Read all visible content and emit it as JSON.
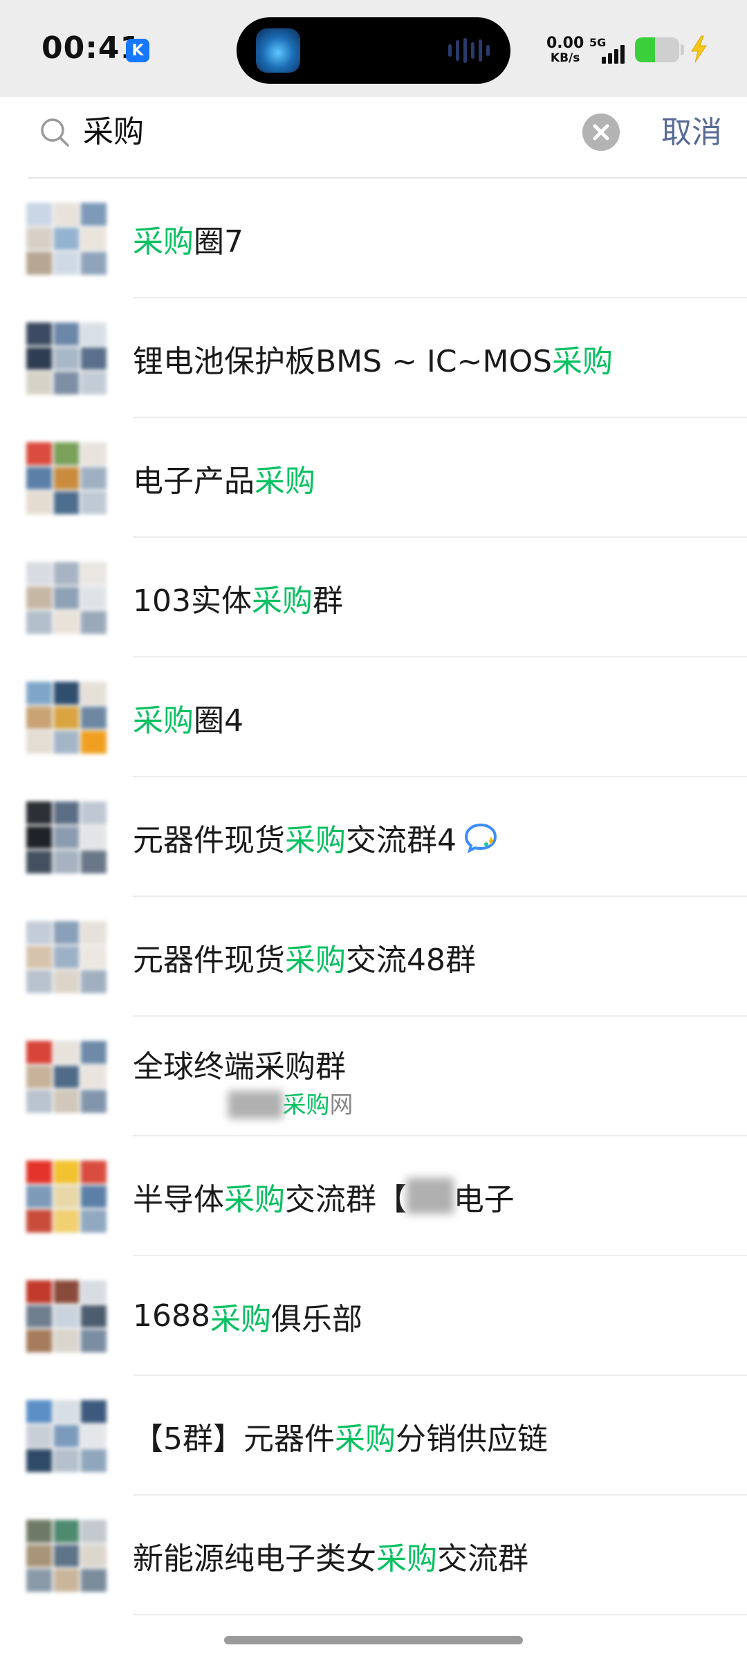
{
  "status_bar": {
    "time": "00:41",
    "badge": "K",
    "net_speed": "0.00",
    "net_unit": "KB/s",
    "net_type": "5G",
    "battery_level": 0.45,
    "charging_icon": "bolt-icon"
  },
  "search": {
    "query": "采购",
    "cancel_label": "取消",
    "search_icon": "search-icon",
    "clear_icon": "clear-icon"
  },
  "results": [
    {
      "pre": "",
      "hl": "采购",
      "post": "圈7",
      "sub_pre": "",
      "sub_hl": "",
      "sub_post": ""
    },
    {
      "pre": "锂电池保护板BMS ~ IC~MOS",
      "hl": "采购",
      "post": "",
      "sub_pre": "",
      "sub_hl": "",
      "sub_post": ""
    },
    {
      "pre": "电子产品",
      "hl": "采购",
      "post": "",
      "sub_pre": "",
      "sub_hl": "",
      "sub_post": ""
    },
    {
      "pre": "103实体",
      "hl": "采购",
      "post": "群",
      "sub_pre": "",
      "sub_hl": "",
      "sub_post": ""
    },
    {
      "pre": "",
      "hl": "采购",
      "post": "圈4",
      "sub_pre": "",
      "sub_hl": "",
      "sub_post": ""
    },
    {
      "pre": "元器件现货",
      "hl": "采购",
      "post": "交流群4",
      "sub_pre": "",
      "sub_hl": "",
      "sub_post": "",
      "icon": "ai-chat-icon"
    },
    {
      "pre": "元器件现货",
      "hl": "采购",
      "post": "交流48群",
      "sub_pre": "",
      "sub_hl": "",
      "sub_post": ""
    },
    {
      "pre": "全球终端采购群",
      "hl": "",
      "post": "",
      "sub_pre": "",
      "sub_hl": "采购",
      "sub_post": "网"
    },
    {
      "pre": "半导体",
      "hl": "采购",
      "post": "交流群【",
      "post2": "电子",
      "sub_pre": "",
      "sub_hl": "",
      "sub_post": ""
    },
    {
      "pre": "1688",
      "hl": "采购",
      "post": "俱乐部",
      "sub_pre": "",
      "sub_hl": "",
      "sub_post": ""
    },
    {
      "pre": "【5群】元器件",
      "hl": "采购",
      "post": "分销供应链",
      "sub_pre": "",
      "sub_hl": "",
      "sub_post": ""
    },
    {
      "pre": "新能源纯电子类女",
      "hl": "采购",
      "post": "交流群",
      "sub_pre": "",
      "sub_hl": "",
      "sub_post": ""
    }
  ],
  "colors": {
    "highlight": "#07c160",
    "cancel": "#576b95",
    "status_bg": "#ededed"
  }
}
